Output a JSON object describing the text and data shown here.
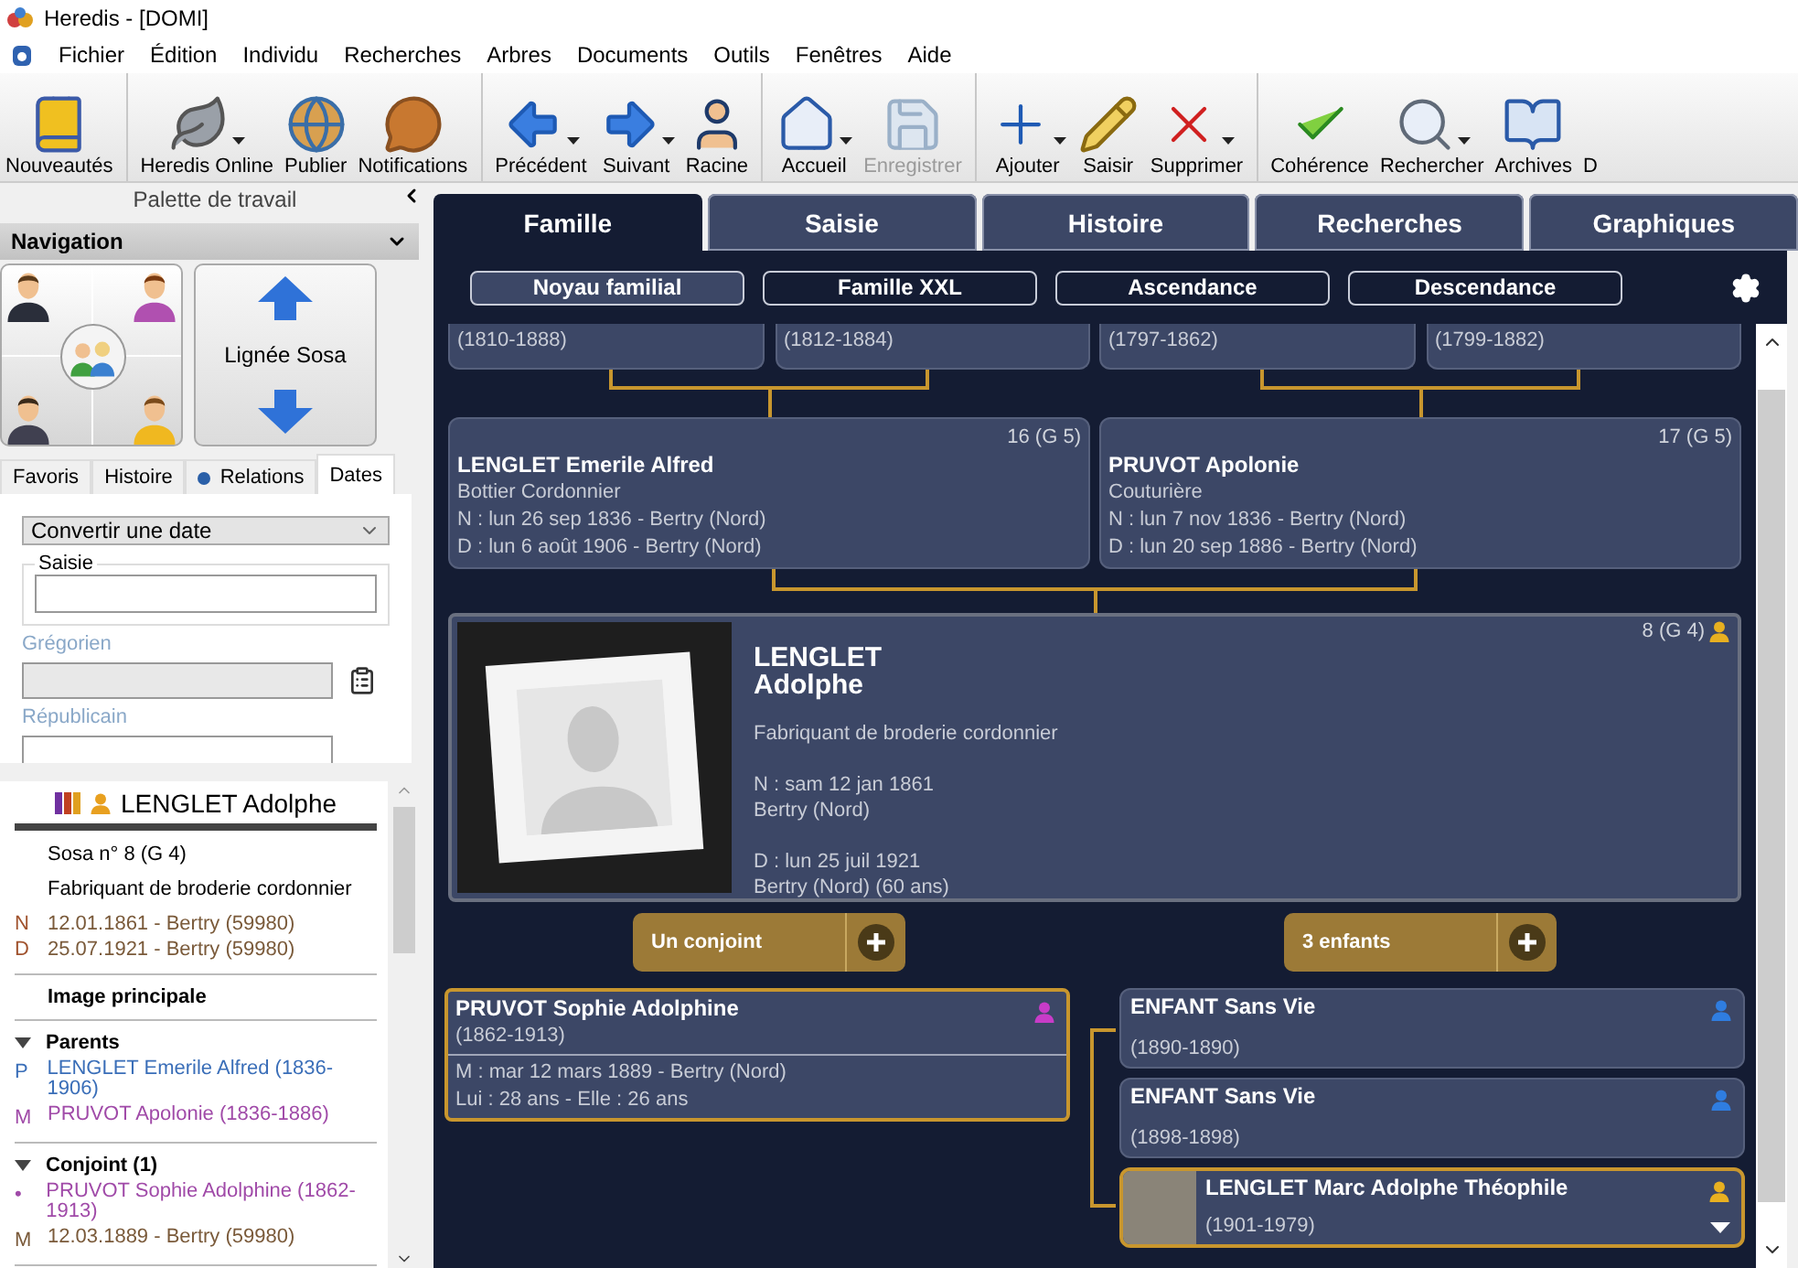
{
  "window": {
    "title": "Heredis - [DOMI]"
  },
  "menu": [
    "Fichier",
    "Édition",
    "Individu",
    "Recherches",
    "Arbres",
    "Documents",
    "Outils",
    "Fenêtres",
    "Aide"
  ],
  "toolbar_groups": [
    [
      {
        "label": "Nouveautés",
        "disabled": false,
        "dropdown": false
      }
    ],
    [
      {
        "label": "Heredis Online",
        "disabled": false,
        "dropdown": true
      },
      {
        "label": "Publier",
        "disabled": false,
        "dropdown": false
      },
      {
        "label": "Notifications",
        "disabled": false,
        "dropdown": false
      }
    ],
    [
      {
        "label": "Précédent",
        "disabled": false,
        "dropdown": true
      },
      {
        "label": "Suivant",
        "disabled": false,
        "dropdown": true
      },
      {
        "label": "Racine",
        "disabled": false,
        "dropdown": false
      }
    ],
    [
      {
        "label": "Accueil",
        "disabled": false,
        "dropdown": true
      },
      {
        "label": "Enregistrer",
        "disabled": true,
        "dropdown": false
      }
    ],
    [
      {
        "label": "Ajouter",
        "disabled": false,
        "dropdown": true
      },
      {
        "label": "Saisir",
        "disabled": false,
        "dropdown": false
      },
      {
        "label": "Supprimer",
        "disabled": false,
        "dropdown": true
      }
    ],
    [
      {
        "label": "Cohérence",
        "disabled": false,
        "dropdown": false
      },
      {
        "label": "Rechercher",
        "disabled": false,
        "dropdown": true
      },
      {
        "label": "Archives",
        "disabled": false,
        "dropdown": false
      },
      {
        "label": "D",
        "disabled": false,
        "dropdown": false
      }
    ]
  ],
  "palette": {
    "title": "Palette de travail",
    "navigation_title": "Navigation",
    "sosa_button": "Lignée Sosa",
    "tabs": [
      {
        "label": "Favoris",
        "selected": false,
        "dot": false
      },
      {
        "label": "Histoire",
        "selected": false,
        "dot": false
      },
      {
        "label": "Relations",
        "selected": false,
        "dot": true
      },
      {
        "label": "Dates",
        "selected": true,
        "dot": false
      }
    ],
    "dates": {
      "converter": "Convertir une date",
      "input_label": "Saisie",
      "gregorian_label": "Grégorien",
      "republican_label": "Républicain"
    }
  },
  "summary": {
    "name": "LENGLET Adolphe",
    "sosa": "Sosa n° 8 (G 4)",
    "occupation": "Fabriquant de broderie cordonnier",
    "events": [
      {
        "letter": "N",
        "text": "12.01.1861 - Bertry (59980)"
      },
      {
        "letter": "D",
        "text": "25.07.1921 - Bertry (59980)"
      }
    ],
    "image_heading": "Image principale",
    "sections": [
      {
        "title": "Parents",
        "expanded": true,
        "entries": [
          {
            "letter": "P",
            "text": "LENGLET Emerile Alfred (1836-1906)",
            "kind": "male"
          },
          {
            "letter": "M",
            "text": "PRUVOT Apolonie (1836-1886)",
            "kind": "female"
          }
        ]
      },
      {
        "title": "Conjoint (1)",
        "expanded": true,
        "entries": [
          {
            "letter": "•",
            "text": "PRUVOT Sophie Adolphine (1862-1913)",
            "kind": "female"
          },
          {
            "letter": "M",
            "text": "12.03.1889 - Bertry (59980)",
            "kind": "event"
          }
        ]
      }
    ]
  },
  "tabs": [
    {
      "label": "Famille",
      "selected": true
    },
    {
      "label": "Saisie",
      "selected": false
    },
    {
      "label": "Histoire",
      "selected": false
    },
    {
      "label": "Recherches",
      "selected": false
    },
    {
      "label": "Graphiques",
      "selected": false
    }
  ],
  "subtabs": [
    {
      "label": "Noyau familial",
      "selected": true
    },
    {
      "label": "Famille XXL",
      "selected": false
    },
    {
      "label": "Ascendance",
      "selected": false
    },
    {
      "label": "Descendance",
      "selected": false
    }
  ],
  "tree": {
    "grandparents": [
      {
        "dates": "(1810-1888)"
      },
      {
        "dates": "(1812-1884)"
      },
      {
        "dates": "(1797-1862)"
      },
      {
        "dates": "(1799-1882)"
      }
    ],
    "parents": [
      {
        "number": "16 (G 5)",
        "name": "LENGLET Emerile Alfred",
        "occupation": "Bottier Cordonnier",
        "birth": "N : lun 26 sep 1836 - Bertry (Nord)",
        "death": "D : lun 6 août 1906 - Bertry (Nord)"
      },
      {
        "number": "17 (G 5)",
        "name": "PRUVOT Apolonie",
        "occupation": "Couturière",
        "birth": "N : lun 7 nov 1836 - Bertry (Nord)",
        "death": "D : lun 20 sep 1886 - Bertry (Nord)"
      }
    ],
    "root": {
      "number": "8 (G 4)",
      "surname": "LENGLET",
      "given": "Adolphe",
      "occupation": "Fabriquant de broderie cordonnier",
      "birth": "N : sam 12 jan 1861",
      "birth_place": "Bertry (Nord)",
      "death": "D : lun 25 juil 1921",
      "death_place": "Bertry (Nord) (60 ans)",
      "color": "#e8b020"
    },
    "spouse_button": "Un conjoint",
    "children_button": "3 enfants",
    "spouse": {
      "name": "PRUVOT Sophie Adolphine",
      "dates": "(1862-1913)",
      "marriage": "M : mar 12 mars 1889 - Bertry (Nord)",
      "ages": "Lui : 28 ans - Elle : 26 ans",
      "color": "#c83cc8"
    },
    "children": [
      {
        "name": "ENFANT Sans Vie",
        "dates": "(1890-1890)",
        "color": "#2f7de0",
        "selected": false,
        "photo": false,
        "expandable": false
      },
      {
        "name": "ENFANT Sans Vie",
        "dates": "(1898-1898)",
        "color": "#2f7de0",
        "selected": false,
        "photo": false,
        "expandable": false
      },
      {
        "name": "LENGLET Marc Adolphe Théophile",
        "dates": "(1901-1979)",
        "color": "#e8b020",
        "selected": true,
        "photo": true,
        "expandable": true
      }
    ]
  }
}
